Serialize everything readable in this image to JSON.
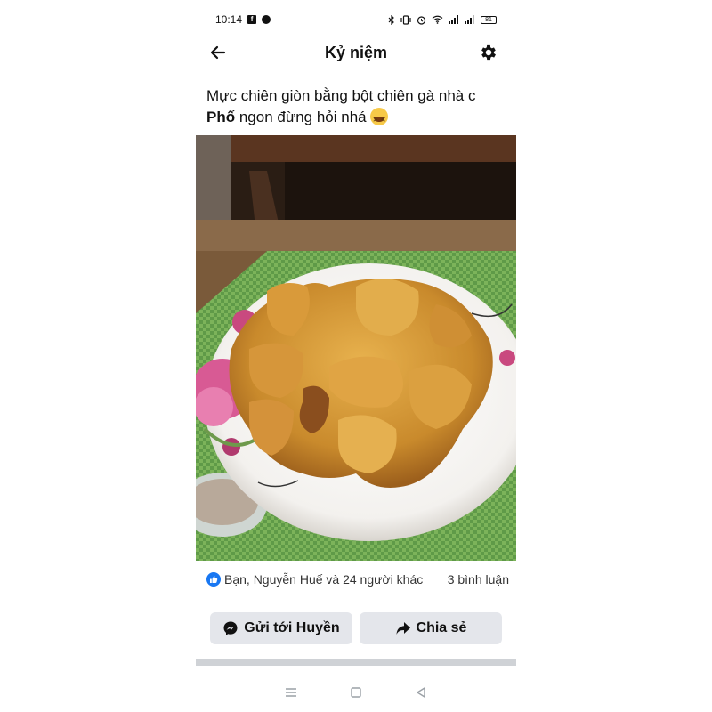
{
  "status_bar": {
    "time": "10:14",
    "battery": "81"
  },
  "header": {
    "title": "Kỷ niệm"
  },
  "post": {
    "text_line1": "Mực chiên giòn bằng bột chiên gà nhà c",
    "text_line2_bold": "Phố",
    "text_line2_rest": " ngon đừng hỏi nhá ",
    "emoji": "laughing-face"
  },
  "photo": {
    "subject": "fried-food-plate"
  },
  "reactions": {
    "text": "Bạn, Nguyễn Huế và 24 người khác",
    "comments": "3 bình luận"
  },
  "actions": {
    "send_label": "Gửi tới Huyền",
    "share_label": "Chia sẻ"
  },
  "colors": {
    "accent": "#1877f2",
    "button_bg": "#e4e6eb"
  }
}
